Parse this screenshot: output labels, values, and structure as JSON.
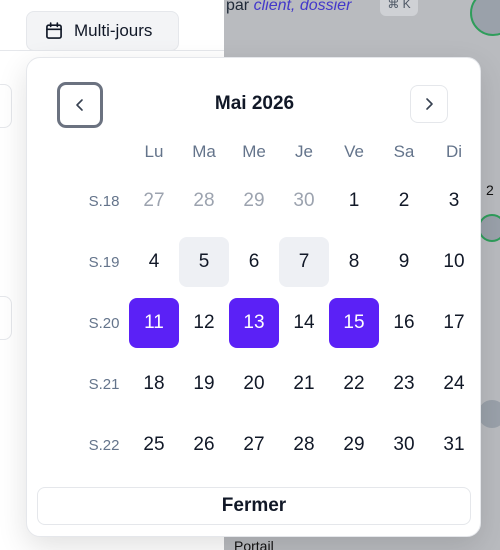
{
  "background": {
    "search_prefix": "par",
    "search_hint": "client, dossier",
    "shortcut": "⌘ K",
    "side_number": "2",
    "bottom_text": "Portail"
  },
  "toolbar": {
    "mode_label": "Multi-jours",
    "mode_icon": "calendar-icon"
  },
  "calendar": {
    "month_label": "Mai 2026",
    "prev_icon": "chevron-left-icon",
    "next_icon": "chevron-right-icon",
    "weekdays": [
      "Lu",
      "Ma",
      "Me",
      "Je",
      "Ve",
      "Sa",
      "Di"
    ],
    "weeks": [
      {
        "label": "S.18",
        "days": [
          {
            "d": "27",
            "state": "outside"
          },
          {
            "d": "28",
            "state": "outside"
          },
          {
            "d": "29",
            "state": "outside"
          },
          {
            "d": "30",
            "state": "outside"
          },
          {
            "d": "1",
            "state": "normal"
          },
          {
            "d": "2",
            "state": "normal"
          },
          {
            "d": "3",
            "state": "normal"
          }
        ]
      },
      {
        "label": "S.19",
        "days": [
          {
            "d": "4",
            "state": "normal"
          },
          {
            "d": "5",
            "state": "highlighted"
          },
          {
            "d": "6",
            "state": "normal"
          },
          {
            "d": "7",
            "state": "highlighted"
          },
          {
            "d": "8",
            "state": "normal"
          },
          {
            "d": "9",
            "state": "normal"
          },
          {
            "d": "10",
            "state": "normal"
          }
        ]
      },
      {
        "label": "S.20",
        "days": [
          {
            "d": "11",
            "state": "selected"
          },
          {
            "d": "12",
            "state": "normal"
          },
          {
            "d": "13",
            "state": "selected"
          },
          {
            "d": "14",
            "state": "normal"
          },
          {
            "d": "15",
            "state": "selected"
          },
          {
            "d": "16",
            "state": "normal"
          },
          {
            "d": "17",
            "state": "normal"
          }
        ]
      },
      {
        "label": "S.21",
        "days": [
          {
            "d": "18",
            "state": "normal"
          },
          {
            "d": "19",
            "state": "normal"
          },
          {
            "d": "20",
            "state": "normal"
          },
          {
            "d": "21",
            "state": "normal"
          },
          {
            "d": "22",
            "state": "normal"
          },
          {
            "d": "23",
            "state": "normal"
          },
          {
            "d": "24",
            "state": "normal"
          }
        ]
      },
      {
        "label": "S.22",
        "days": [
          {
            "d": "25",
            "state": "normal"
          },
          {
            "d": "26",
            "state": "normal"
          },
          {
            "d": "27",
            "state": "normal"
          },
          {
            "d": "28",
            "state": "normal"
          },
          {
            "d": "29",
            "state": "normal"
          },
          {
            "d": "30",
            "state": "normal"
          },
          {
            "d": "31",
            "state": "normal"
          }
        ]
      }
    ],
    "close_label": "Fermer"
  },
  "colors": {
    "selected": "#5b21f6",
    "highlighted": "#eef0f4",
    "muted": "#64748b"
  }
}
